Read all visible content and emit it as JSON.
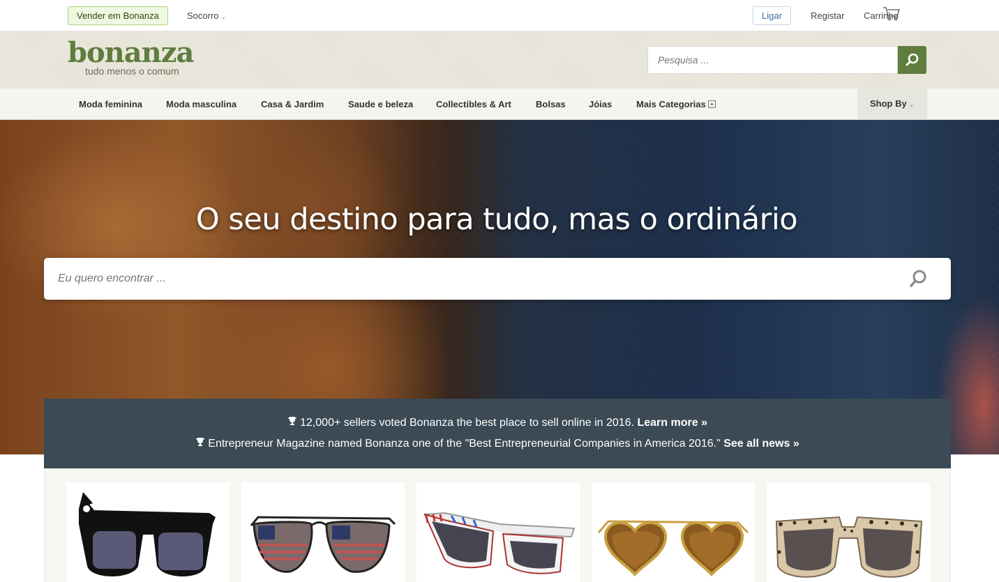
{
  "topbar": {
    "sell_label": "Vender em Bonanza",
    "help_label": "Socorro",
    "login_label": "Ligar",
    "register_label": "Registar",
    "cart_label": "Carrinho",
    "cart_icon": "shopping-cart-icon"
  },
  "header": {
    "logo_text": "bonanza",
    "tagline": "tudo menos o comum",
    "search_placeholder": "Pesquisa ...",
    "brand_color": "#5e7d3e"
  },
  "categories": [
    "Moda feminina",
    "Moda masculina",
    "Casa & Jardim",
    "Saude e beleza",
    "Collectibles & Art",
    "Bolsas",
    "Jóias",
    "Mais Categorias"
  ],
  "shop_by_label": "Shop By",
  "hero": {
    "title": "O seu destino para tudo, mas o ordinário",
    "search_placeholder": "Eu quero encontrar ..."
  },
  "announcements": [
    {
      "text": "12,000+ sellers voted Bonanza the best place to sell online in 2016.",
      "link": "Learn more »"
    },
    {
      "text": "Entrepreneur Magazine named Bonanza one of the \"Best Entrepreneurial Companies in America 2016.\"",
      "link": "See all news »"
    }
  ],
  "products": [
    {
      "icon": "cat-ear-sunglasses"
    },
    {
      "icon": "american-flag-aviator-sunglasses"
    },
    {
      "icon": "newspaper-print-sunglasses"
    },
    {
      "icon": "heart-shaped-sunglasses"
    },
    {
      "icon": "leopard-print-sunglasses"
    }
  ]
}
